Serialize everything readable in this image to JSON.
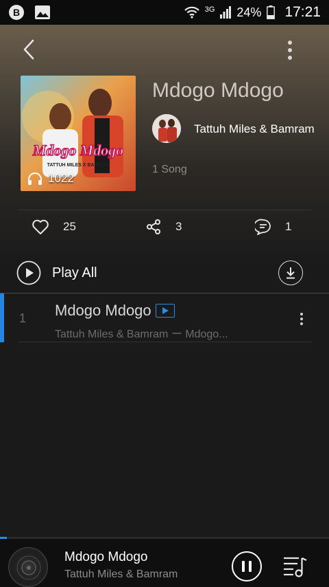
{
  "status_bar": {
    "network": "3G",
    "battery": "24%",
    "time": "17:21"
  },
  "album": {
    "title": "Mdogo Mdogo",
    "artist": "Tattuh Miles & Bamram",
    "song_count": "1 Song",
    "cover_listen_count": "1022"
  },
  "actions": {
    "likes": "25",
    "shares": "3",
    "comments": "1"
  },
  "play_all": {
    "label": "Play All"
  },
  "tracks": [
    {
      "index": "1",
      "title": "Mdogo Mdogo",
      "subtitle": "Tattuh Miles & Bamram ー Mdogo..."
    }
  ],
  "now_playing": {
    "title": "Mdogo Mdogo",
    "artist": "Tattuh Miles & Bamram",
    "progress": 0.02
  },
  "colors": {
    "accent": "#2486e0",
    "background": "#1a1a1b",
    "header_top": "#6a5d4b"
  },
  "icons": [
    "back-arrow-icon",
    "more-vertical-icon",
    "headphones-icon",
    "heart-icon",
    "share-icon",
    "comment-icon",
    "play-circle-icon",
    "download-icon",
    "mv-video-icon",
    "pause-icon",
    "playlist-queue-icon",
    "disc-icon"
  ]
}
